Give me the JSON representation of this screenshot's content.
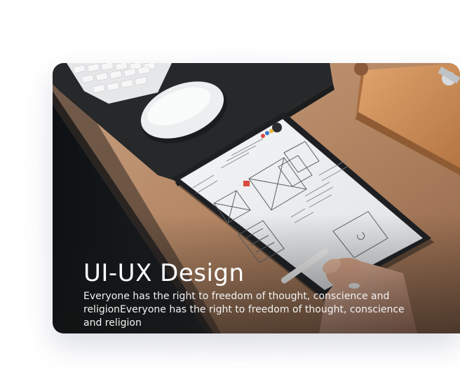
{
  "card": {
    "title": "UI-UX Design",
    "description": "Everyone has the right to freedom of thought, conscience and religionEveryone has the right to freedom of thought, conscience and religion"
  },
  "photo": {
    "subject": "tablet-wireframe-sketch-on-desk",
    "colors": {
      "desk": "#b38563",
      "mat": "#262829",
      "shadow": "#15181b",
      "tablet_bezel": "#1d1f22",
      "screen": "#eceef0",
      "block": "#c98a57"
    }
  }
}
